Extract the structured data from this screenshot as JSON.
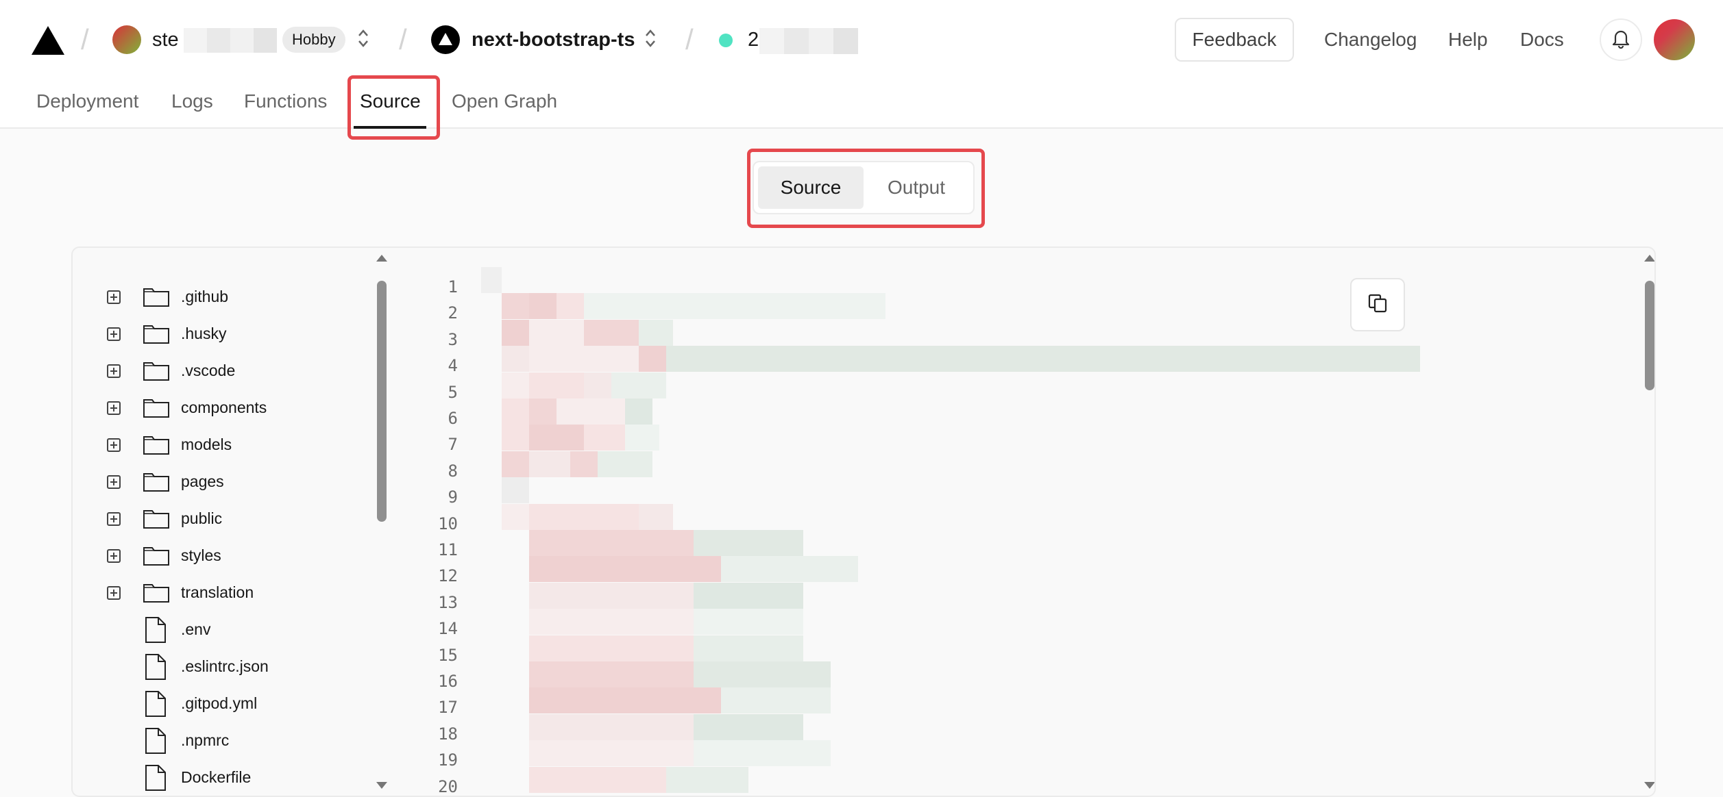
{
  "header": {
    "team": {
      "name_visible": "ste",
      "plan_badge": "Hobby"
    },
    "project": {
      "name": "next-bootstrap-ts"
    },
    "deployment": {
      "id_visible": "2"
    },
    "feedback_label": "Feedback",
    "nav": [
      "Changelog",
      "Help",
      "Docs"
    ]
  },
  "tabs": [
    "Deployment",
    "Logs",
    "Functions",
    "Source",
    "Open Graph"
  ],
  "active_tab": "Source",
  "view_toggle": {
    "options": [
      "Source",
      "Output"
    ],
    "active": "Source"
  },
  "file_tree": {
    "folders": [
      ".github",
      ".husky",
      ".vscode",
      "components",
      "models",
      "pages",
      "public",
      "styles",
      "translation"
    ],
    "files": [
      ".env",
      ".eslintrc.json",
      ".gitpod.yml",
      ".npmrc",
      "Dockerfile"
    ]
  },
  "code_view": {
    "line_numbers": [
      "1",
      "2",
      "3",
      "4",
      "5",
      "6",
      "7",
      "8",
      "9",
      "10",
      "11",
      "12",
      "13",
      "14",
      "15",
      "16",
      "17",
      "18",
      "19",
      "20"
    ]
  },
  "colors": {
    "accent_highlight": "#e5484d",
    "status_ready": "#50e3c2"
  },
  "icons": [
    "vercel-logo-icon",
    "chevron-up-down-icon",
    "bell-icon",
    "folder-icon",
    "file-icon",
    "expand-plus-icon",
    "copy-icon"
  ]
}
